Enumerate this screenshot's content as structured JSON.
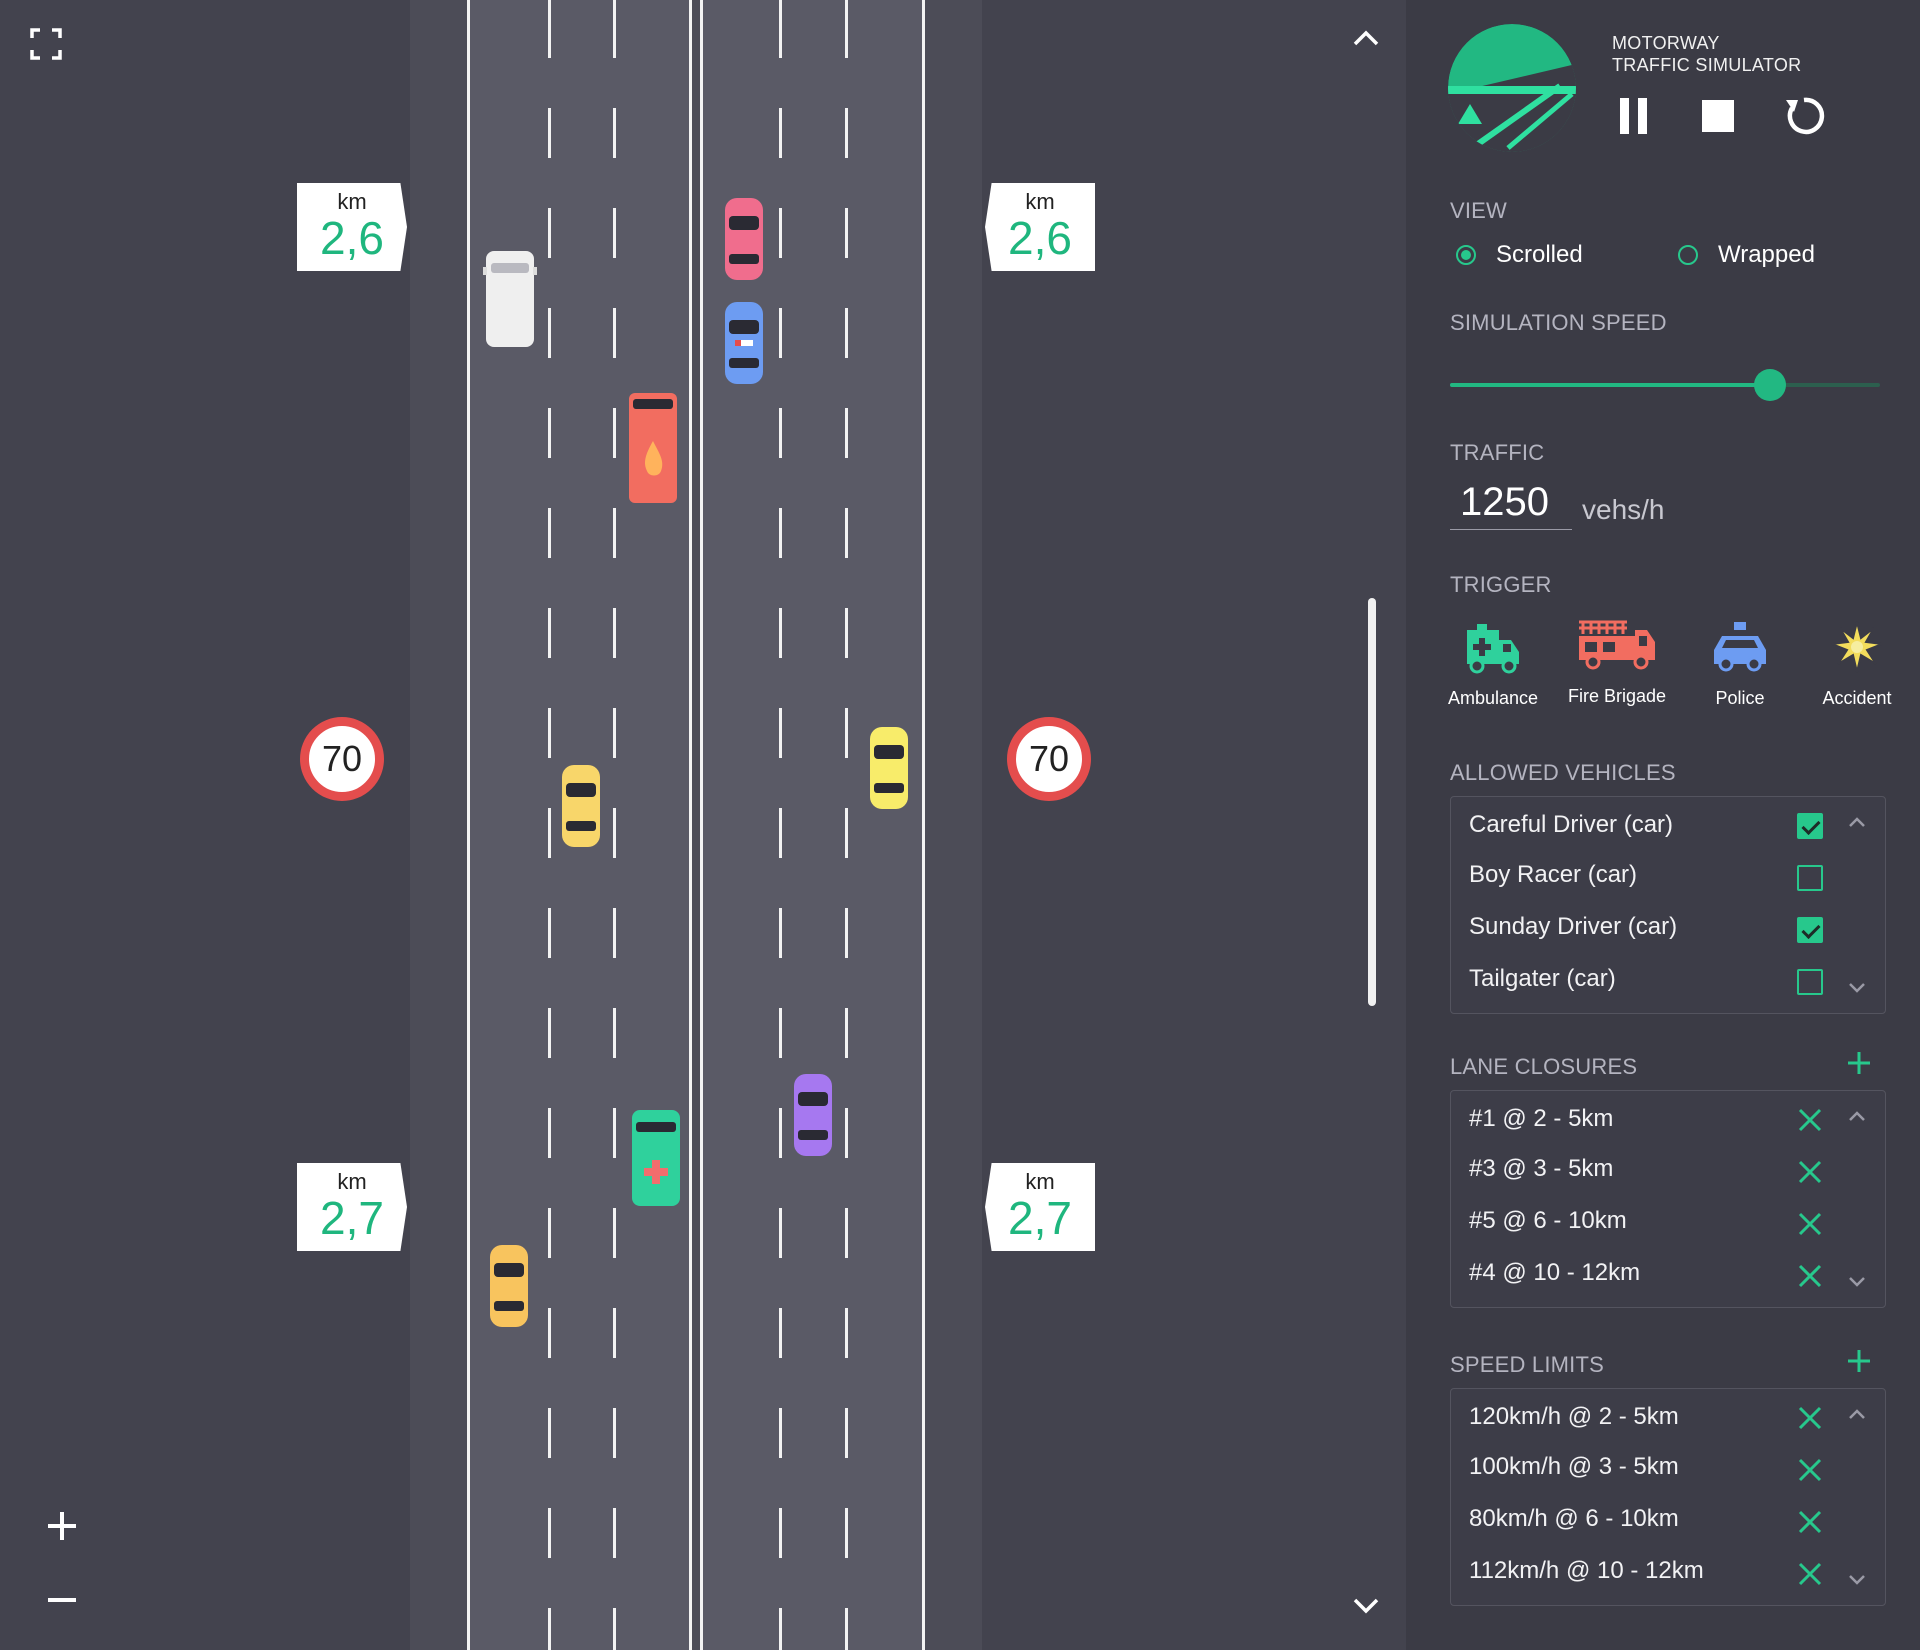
{
  "app": {
    "title_line1": "MOTORWAY",
    "title_line2": "TRAFFIC SIMULATOR"
  },
  "colors": {
    "accent": "#22b882",
    "stop_red": "#e44d4d",
    "road": "#5a5a66",
    "panel": "#3b3b45"
  },
  "map": {
    "km_signs": [
      {
        "unit": "km",
        "value": "2,6"
      },
      {
        "unit": "km",
        "value": "2,6"
      },
      {
        "unit": "km",
        "value": "2,7"
      },
      {
        "unit": "km",
        "value": "2,7"
      }
    ],
    "speed_signs": [
      "70",
      "70"
    ],
    "icons": {
      "fullscreen": "fullscreen-icon",
      "zoom_in": "plus-icon",
      "zoom_out": "minus-icon",
      "scroll_up": "chevron-up-icon",
      "scroll_down": "chevron-down-icon"
    }
  },
  "controls": {
    "pause": "pause-icon",
    "stop": "stop-icon",
    "restart": "restart-icon"
  },
  "view": {
    "label": "VIEW",
    "options": [
      {
        "label": "Scrolled",
        "selected": true
      },
      {
        "label": "Wrapped",
        "selected": false
      }
    ]
  },
  "simulation_speed": {
    "label": "SIMULATION SPEED",
    "value_fraction": 0.745
  },
  "traffic": {
    "label": "TRAFFIC",
    "value": "1250",
    "unit": "vehs/h"
  },
  "trigger": {
    "label": "TRIGGER",
    "items": [
      {
        "label": "Ambulance",
        "icon": "ambulance-icon"
      },
      {
        "label": "Fire Brigade",
        "icon": "fire-truck-icon"
      },
      {
        "label": "Police",
        "icon": "police-car-icon"
      },
      {
        "label": "Accident",
        "icon": "accident-icon"
      }
    ]
  },
  "allowed_vehicles": {
    "label": "ALLOWED VEHICLES",
    "items": [
      {
        "label": "Careful Driver (car)",
        "checked": true
      },
      {
        "label": "Boy Racer (car)",
        "checked": false
      },
      {
        "label": "Sunday Driver (car)",
        "checked": true
      },
      {
        "label": "Tailgater (car)",
        "checked": false
      }
    ]
  },
  "lane_closures": {
    "label": "LANE CLOSURES",
    "items": [
      "#1 @ 2 - 5km",
      "#3 @ 3 - 5km",
      "#5 @ 6 - 10km",
      "#4 @ 10 - 12km"
    ]
  },
  "speed_limits": {
    "label": "SPEED LIMITS",
    "items": [
      "120km/h @ 2 - 5km",
      "100km/h @ 3 - 5km",
      "80km/h @ 6 - 10km",
      "112km/h @ 10 - 12km"
    ]
  }
}
